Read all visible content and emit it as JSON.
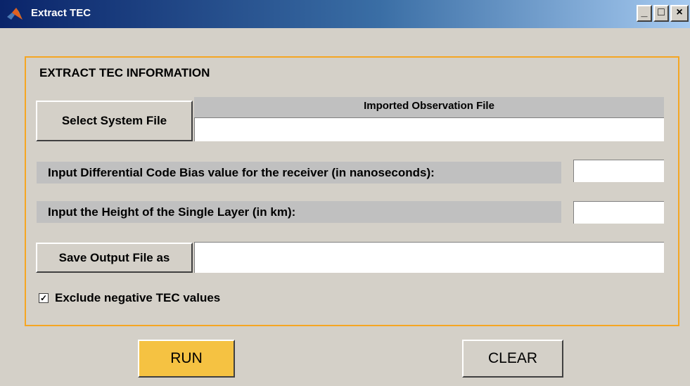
{
  "window": {
    "title": "Extract TEC",
    "controls": {
      "minimize": "_",
      "maximize": "□",
      "close": "×"
    }
  },
  "panel": {
    "title": "EXTRACT TEC INFORMATION",
    "select_file_label": "Select System File",
    "imported_header": "Imported Observation File",
    "imported_value": "",
    "dcb_label": "Input Differential Code Bias value for the receiver (in nanoseconds):",
    "dcb_value": "",
    "height_label": "Input the Height of the Single Layer (in km):",
    "height_value": "",
    "save_label": "Save Output File as",
    "save_value": "",
    "exclude_checkbox": {
      "label": "Exclude negative TEC values",
      "checked": true,
      "mark": "✓"
    }
  },
  "actions": {
    "run_label": "RUN",
    "clear_label": "CLEAR"
  },
  "colors": {
    "panel_border": "#f5a623",
    "run_button": "#f5c242",
    "background": "#d4d0c8"
  }
}
